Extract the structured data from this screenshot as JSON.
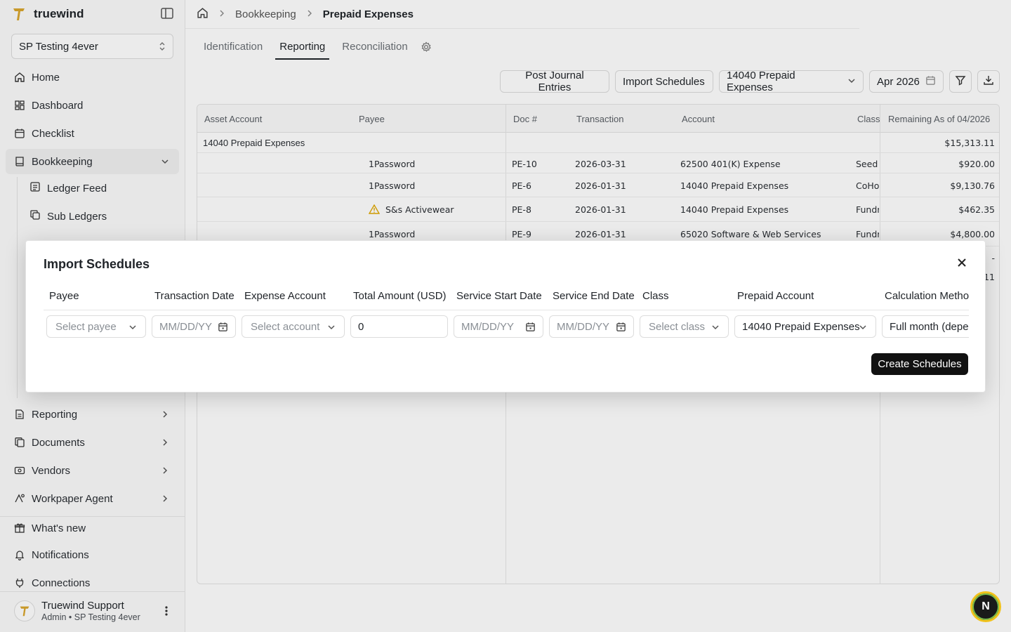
{
  "app": {
    "brand": "truewind",
    "org": "SP Testing 4ever"
  },
  "sidebar": {
    "items": [
      {
        "label": "Home"
      },
      {
        "label": "Dashboard"
      },
      {
        "label": "Checklist"
      },
      {
        "label": "Bookkeeping"
      },
      {
        "label": "Reporting"
      },
      {
        "label": "Documents"
      },
      {
        "label": "Vendors"
      },
      {
        "label": "Workpaper Agent"
      },
      {
        "label": "What's new"
      },
      {
        "label": "Notifications"
      },
      {
        "label": "Connections"
      }
    ],
    "subitems": [
      {
        "label": "Ledger Feed"
      },
      {
        "label": "Sub Ledgers"
      }
    ],
    "user": {
      "name": "Truewind Support",
      "role": "Admin • SP Testing 4ever"
    }
  },
  "breadcrumb": {
    "section": "Bookkeeping",
    "current": "Prepaid Expenses"
  },
  "tabs": [
    {
      "label": "Identification"
    },
    {
      "label": "Reporting"
    },
    {
      "label": "Reconciliation"
    }
  ],
  "toolbar": {
    "post_label": "Post Journal Entries",
    "import_label": "Import Schedules",
    "account_filter": "14040 Prepaid Expenses",
    "period": "Apr 2026"
  },
  "table": {
    "headers": [
      "Asset Account",
      "Payee",
      "Doc #",
      "Transaction",
      "Account",
      "Class",
      "Remaining As of 04/2026"
    ],
    "group": {
      "name": "14040 Prepaid Expenses",
      "remaining": "$15,313.11"
    },
    "rows": [
      {
        "payee": "1Password",
        "doc": "PE-10",
        "date": "2026-03-31",
        "account": "62500 401(K) Expense",
        "class": "Seed I",
        "remaining": "$920.00"
      },
      {
        "payee": "1Password",
        "doc": "PE-6",
        "date": "2026-01-31",
        "account": "14040 Prepaid Expenses",
        "class": "CoHos",
        "remaining": "$9,130.76"
      },
      {
        "payee": "S&s Activewear",
        "doc": "PE-8",
        "date": "2026-01-31",
        "account": "14040 Prepaid Expenses",
        "class": "Fundr",
        "remaining": "$462.35"
      },
      {
        "payee": "1Password",
        "doc": "PE-9",
        "date": "2026-01-31",
        "account": "65020 Software & Web Services",
        "class": "Fundr",
        "remaining": "$4,800.00"
      }
    ],
    "partial": [
      "-",
      "11"
    ]
  },
  "modal": {
    "title": "Import Schedules",
    "columns": [
      "Payee",
      "Transaction Date",
      "Expense Account",
      "Total Amount (USD)",
      "Service Start Date",
      "Service End Date",
      "Class",
      "Prepaid Account",
      "Calculation Metho"
    ],
    "fields": {
      "payee_placeholder": "Select payee",
      "txn_date_placeholder": "MM/DD/YY",
      "expense_placeholder": "Select account",
      "amount_value": "0",
      "start_placeholder": "MM/DD/YY",
      "end_placeholder": "MM/DD/YY",
      "class_placeholder": "Select class",
      "prepaid_value": "14040 Prepaid Expenses",
      "calc_value": "Full month (deper"
    },
    "create_label": "Create Schedules"
  },
  "fab": {
    "label": "N"
  },
  "colors": {
    "accent": "#111111",
    "brand": "#d4a017",
    "warning": "#e0a800"
  }
}
